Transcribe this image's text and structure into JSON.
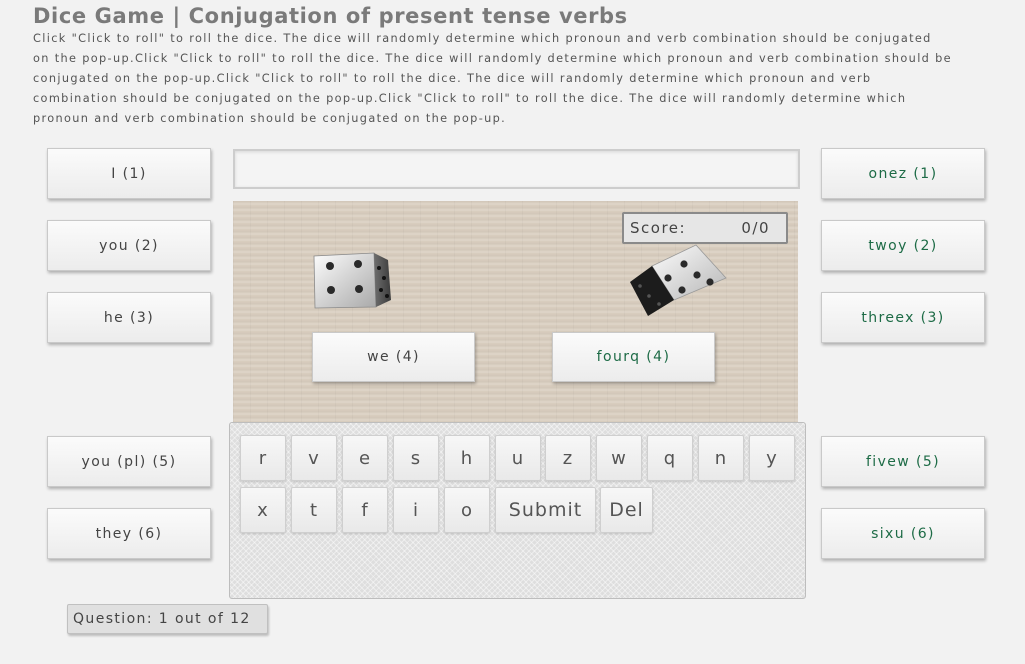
{
  "title": "Dice Game | Conjugation of present tense verbs",
  "instructions": "Click \"Click to roll\" to roll the dice. The dice will randomly determine which pronoun and verb combination should be conjugated on the pop-up.Click \"Click to roll\" to roll the dice. The dice will randomly determine which pronoun and verb combination should be conjugated on the pop-up.Click \"Click to roll\" to roll the dice. The dice will randomly determine which pronoun and verb combination should be conjugated on the pop-up.Click \"Click to roll\" to roll the dice. The dice will randomly determine which pronoun and verb combination should be conjugated on the pop-up.",
  "pronouns": [
    "I (1)",
    "you (2)",
    "he (3)",
    "we (4)",
    "you (pl) (5)",
    "they (6)"
  ],
  "verbs": [
    "onez (1)",
    "twoy (2)",
    "threex (3)",
    "fourq (4)",
    "fivew (5)",
    "sixu (6)"
  ],
  "answer": {
    "value": ""
  },
  "score": {
    "label": "Score:",
    "value": "0/0"
  },
  "keyboard": {
    "row1": [
      "r",
      "v",
      "e",
      "s",
      "h",
      "u",
      "z",
      "w",
      "q",
      "n",
      "y"
    ],
    "row2": [
      "x",
      "t",
      "f",
      "i",
      "o"
    ],
    "submit": "Submit",
    "delete": "Del"
  },
  "question": "Question: 1 out of 12",
  "colors": {
    "verb_text": "#1d6b46",
    "board": "#d9cebf",
    "background": "#f2f2f2"
  }
}
